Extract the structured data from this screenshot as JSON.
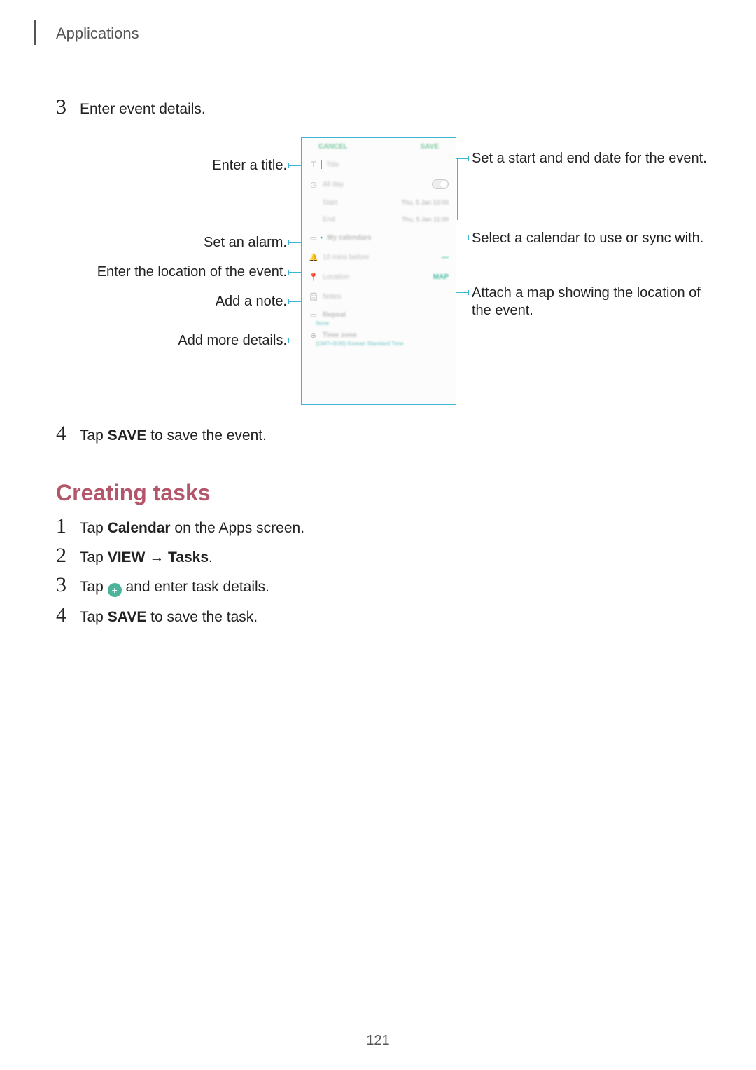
{
  "header": {
    "section": "Applications"
  },
  "step3": {
    "num": "3",
    "text": "Enter event details."
  },
  "diagram": {
    "callouts": {
      "title": "Enter a title.",
      "date": "Set a start and end date for the event.",
      "alarm": "Set an alarm.",
      "calendar": "Select a calendar to use or sync with.",
      "location": "Enter the location of the event.",
      "map": "Attach a map showing the location of the event.",
      "note": "Add a note.",
      "more": "Add more details."
    },
    "phone": {
      "cancel": "CANCEL",
      "save": "SAVE",
      "title_placeholder": "Title",
      "allday": "All day",
      "start_label": "Start",
      "end_label": "End",
      "start_value": "Thu, 5 Jan  10:00",
      "end_value": "Thu, 5 Jan  11:00",
      "my_calendars": "My calendars",
      "reminder": "10 mins before",
      "location": "Location",
      "notes": "Notes",
      "repeat": "Repeat",
      "repeat_sub": "None",
      "timezone": "Time zone",
      "timezone_sub": "(GMT+9:00) Korean Standard Time",
      "map": "MAP",
      "remove": "—"
    }
  },
  "step4": {
    "num": "4",
    "prefix": "Tap ",
    "bold": "SAVE",
    "suffix": " to save the event."
  },
  "heading": "Creating tasks",
  "tasks": {
    "s1": {
      "num": "1",
      "prefix": "Tap ",
      "bold": "Calendar",
      "suffix": " on the Apps screen."
    },
    "s2": {
      "num": "2",
      "prefix": "Tap ",
      "bold1": "VIEW",
      "arrow": " → ",
      "bold2": "Tasks",
      "suffix": "."
    },
    "s3": {
      "num": "3",
      "prefix": "Tap ",
      "plus": "+",
      "suffix": " and enter task details."
    },
    "s4": {
      "num": "4",
      "prefix": "Tap ",
      "bold": "SAVE",
      "suffix": " to save the task."
    }
  },
  "pagenum": "121"
}
